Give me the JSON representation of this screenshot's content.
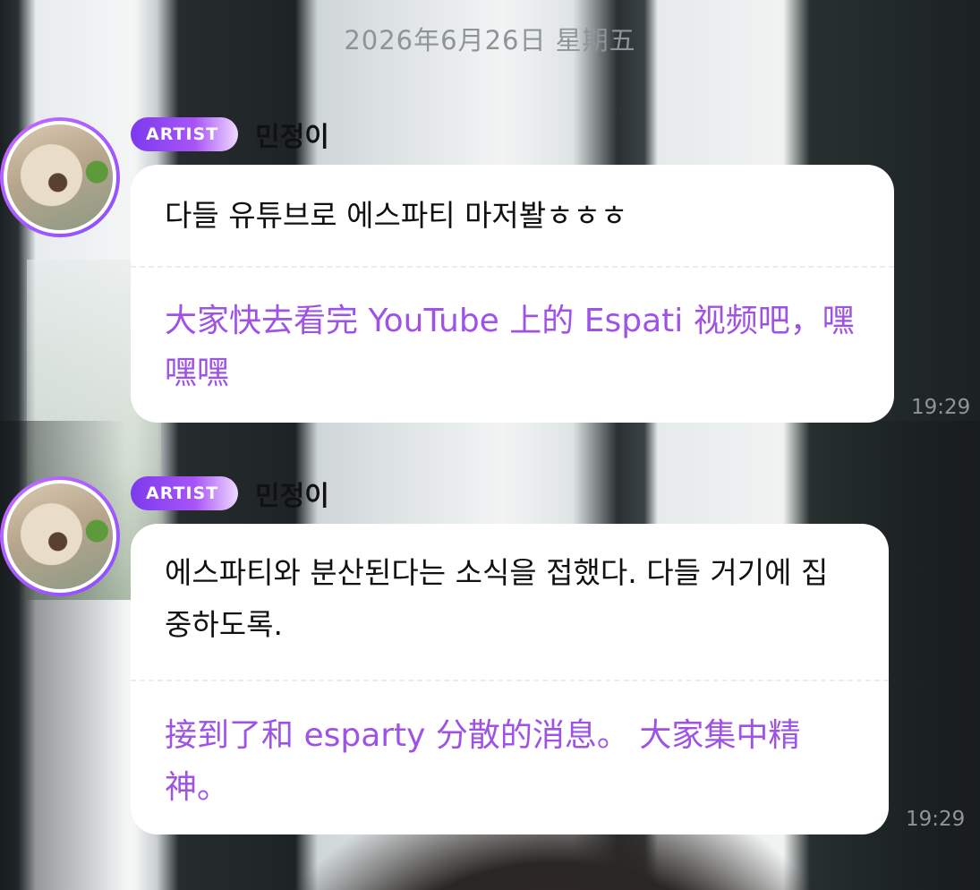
{
  "date_separator": "2026年6月26日 星期五",
  "messages": [
    {
      "badge": "ARTIST",
      "sender": "민정이",
      "original": "다들 유튜브로 에스파티 마저봘ㅎㅎㅎ",
      "translation": "大家快去看完 YouTube 上的 Espati 视频吧，嘿嘿嘿",
      "time": "19:29"
    },
    {
      "badge": "ARTIST",
      "sender": "민정이",
      "original": "에스파티와 분산된다는 소식을 접했다. 다들 거기에 집중하도록.",
      "translation": "接到了和 esparty 分散的消息。 大家集中精神。",
      "time": "19:29"
    }
  ],
  "colors": {
    "badge_start": "#7c3aed",
    "translation_text": "#9f52e6",
    "avatar_ring": "#c56bff"
  }
}
